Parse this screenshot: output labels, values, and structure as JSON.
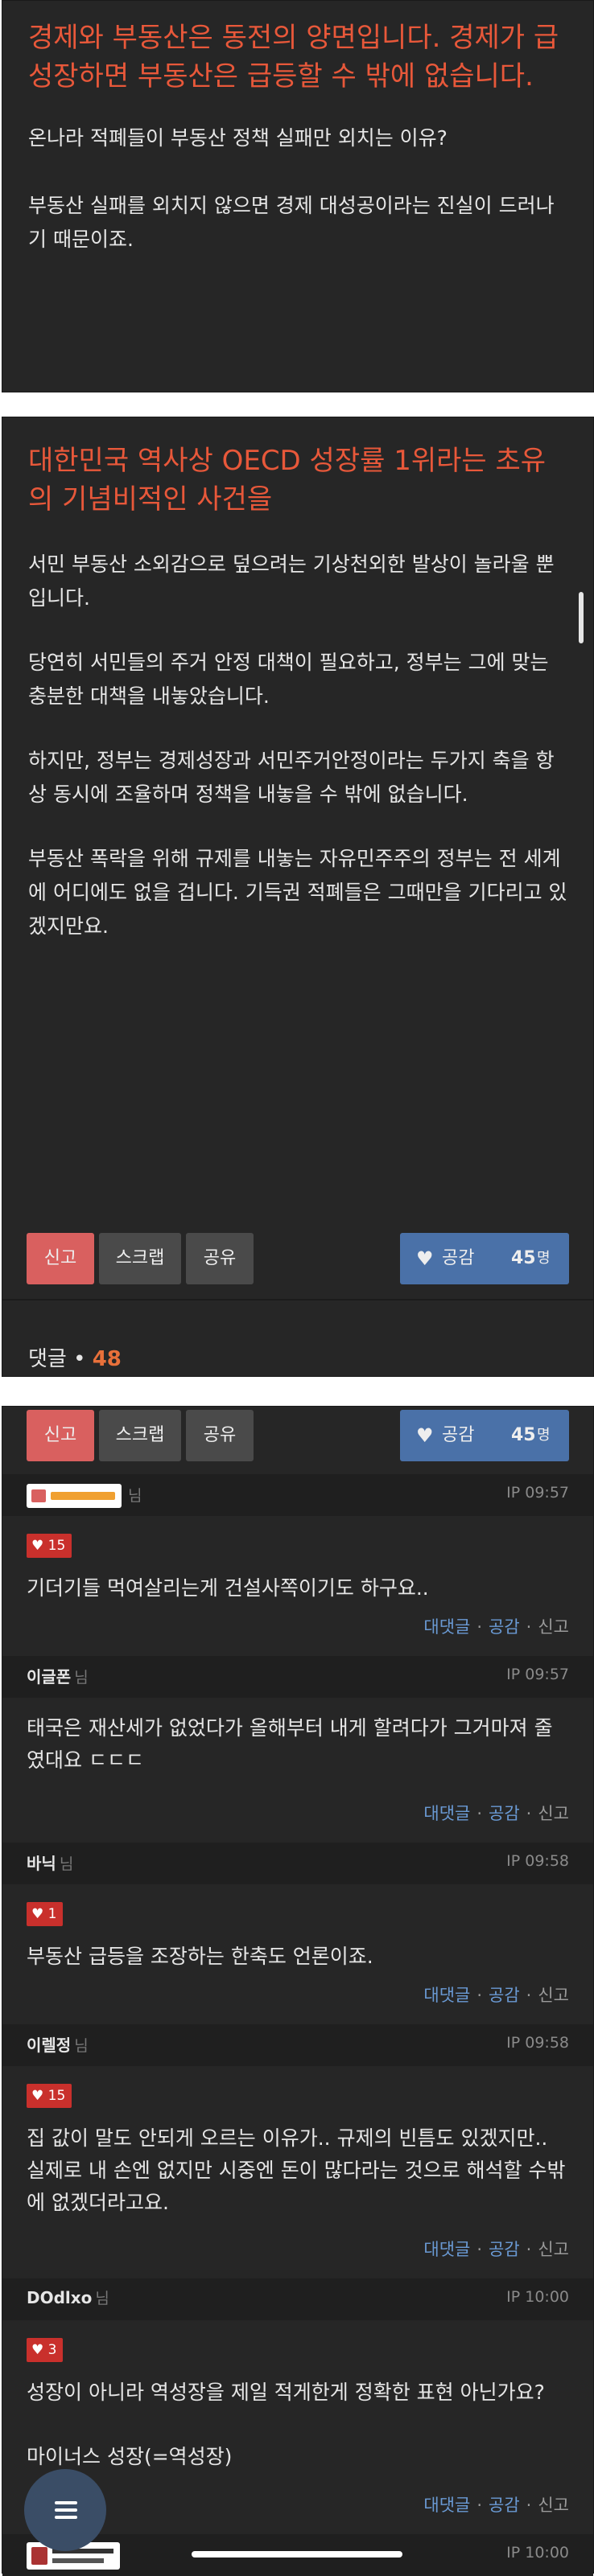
{
  "post": {
    "headline1": "경제와 부동산은 동전의 양면입니다. 경제가 급성장하면 부동산은 급등할 수 밖에 없습니다.",
    "p1": "온나라 적폐들이 부동산 정책 실패만 외치는 이유?",
    "p2": "부동산 실패를 외치지 않으면 경제 대성공이라는 진실이 드러나기 때문이죠.",
    "headline2": "대한민국 역사상 OECD 성장률 1위라는 초유의 기념비적인 사건을",
    "p3": "서민 부동산 소외감으로 덮으려는 기상천외한 발상이 놀라울 뿐입니다.",
    "p4": "당연히 서민들의 주거 안정 대책이 필요하고, 정부는 그에 맞는 충분한 대책을 내놓았습니다.",
    "p5": "하지만, 정부는 경제성장과 서민주거안정이라는 두가지 축을 항상 동시에 조율하며 정책을 내놓을 수 밖에 없습니다.",
    "p6": "부동산 폭락을 위해 규제를 내놓는 자유민주주의 정부는 전 세계에 어디에도 없을 겁니다. 기득권 적폐들은 그때만을 기다리고 있겠지만요."
  },
  "actions": {
    "report": "신고",
    "scrap": "스크랩",
    "share": "공유",
    "like": "공감",
    "like_count": "45",
    "like_unit": "명"
  },
  "comments_header": {
    "label": "댓글",
    "count": "48"
  },
  "comments": [
    {
      "name": "",
      "ip": "IP 09:57",
      "likes": "15",
      "text": "기더기들 먹여살리는게 건설사쪽이기도 하구요.."
    },
    {
      "name": "이글폰",
      "ip": "IP 09:57",
      "likes": "",
      "text": "태국은 재산세가 없었다가 올해부터 내게 할려다가 그거마져 줄였대요 ㄷㄷㄷ"
    },
    {
      "name": "바닉",
      "ip": "IP 09:58",
      "likes": "1",
      "text": "부동산 급등을 조장하는 한축도 언론이죠."
    },
    {
      "name": "이렐정",
      "ip": "IP 09:58",
      "likes": "15",
      "text": "집 값이 말도 안되게 오르는 이유가.. 규제의 빈틈도 있겠지만.. 실제로 내 손엔 없지만 시중엔 돈이 많다라는 것으로 해석할 수밖에 없겠더라고요."
    },
    {
      "name": "DOdlxo",
      "ip": "IP 10:00",
      "likes": "3",
      "text": "성장이 아니라 역성장을 제일 적게한게 정확한 표현 아닌가요?",
      "text2": "마이너스 성장(=역성장)"
    },
    {
      "name": "",
      "ip": "IP 10:00"
    }
  ],
  "comment_links": {
    "reply": "대댓글",
    "like": "공감",
    "report": "신고"
  },
  "suffix": "님",
  "colors": {
    "background": "#262626",
    "headline": "#e8583a",
    "report_button": "#d9605f",
    "like_button": "#4a71a8",
    "link": "#6a9ad4"
  }
}
